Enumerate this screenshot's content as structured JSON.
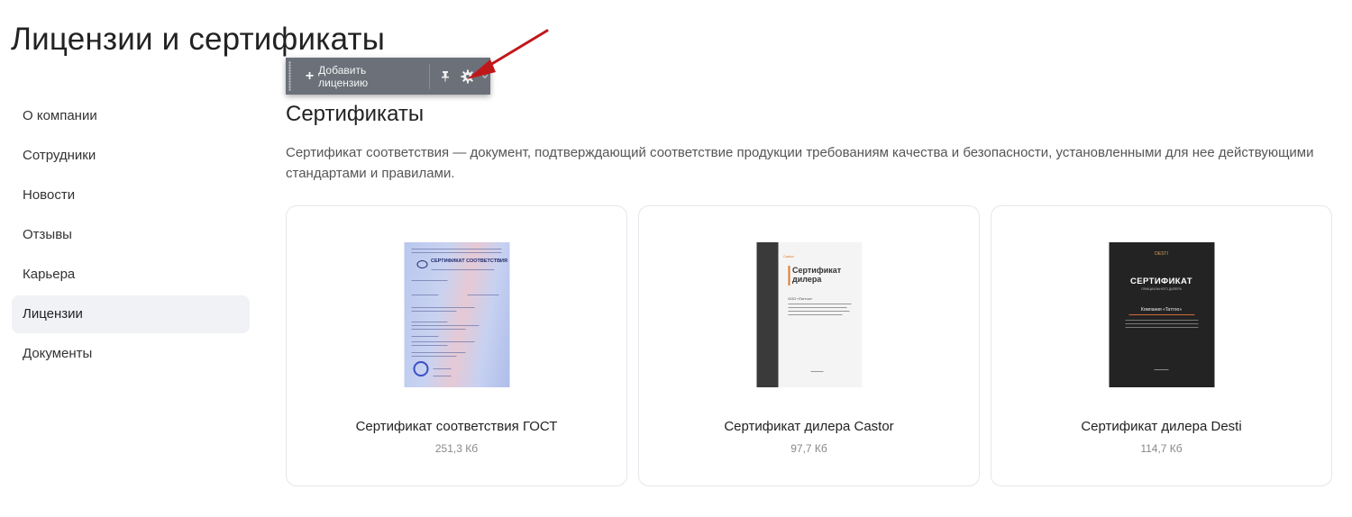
{
  "page": {
    "title": "Лицензии и сертификаты"
  },
  "sidebar": {
    "items": [
      {
        "label": "О компании"
      },
      {
        "label": "Сотрудники"
      },
      {
        "label": "Новости"
      },
      {
        "label": "Отзывы"
      },
      {
        "label": "Карьера"
      },
      {
        "label": "Лицензии",
        "active": true
      },
      {
        "label": "Документы"
      }
    ]
  },
  "toolbar": {
    "add_label": "Добавить лицензию",
    "icons": [
      "plus-icon",
      "pin-icon",
      "gear-icon",
      "chevron-down-icon"
    ]
  },
  "annotation": {
    "arrow_color": "#c0171b"
  },
  "section": {
    "title": "Сертификаты",
    "description": "Сертификат соответствия — документ, подтверждающий соответствие продукции требованиям качества и безопасности, установленными для нее действующими стандартами и правилами."
  },
  "cards": [
    {
      "name": "Сертификат соответствия ГОСТ",
      "size": "251,3 Кб",
      "thumb": {
        "heading": "СЕРТИФИКАТ СООТВЕТСТВИЯ"
      }
    },
    {
      "name": "Сертификат дилера Castor",
      "size": "97,7 Кб",
      "thumb": {
        "brand": "Castor",
        "heading": "Сертификат дилера",
        "company": "ООО «Taттoo»"
      }
    },
    {
      "name": "Сертификат дилера Desti",
      "size": "114,7 Кб",
      "thumb": {
        "brand": "DESTI",
        "heading": "СЕРТИФИКАТ",
        "subheading": "ОФИЦИАЛЬНОГО ДИЛЕРА",
        "company": "Компания «Taттoo»"
      }
    }
  ]
}
